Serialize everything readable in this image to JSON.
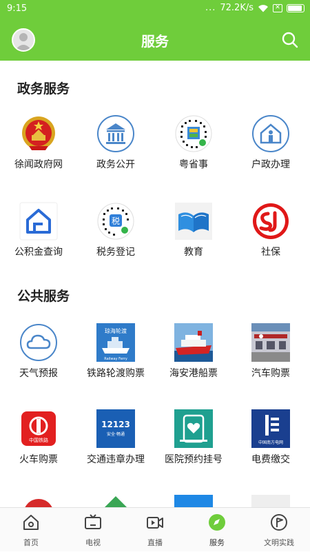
{
  "status_bar": {
    "time": "9:15",
    "dots": "...",
    "speed": "72.2K/s"
  },
  "header": {
    "title": "服务"
  },
  "sections": [
    {
      "title": "政务服务",
      "items": [
        {
          "label": "徐闻政府网",
          "icon": "national-emblem-icon"
        },
        {
          "label": "政务公开",
          "icon": "government-building-icon"
        },
        {
          "label": "粤省事",
          "icon": "mini-program-qr-icon"
        },
        {
          "label": "户政办理",
          "icon": "household-house-icon"
        },
        {
          "label": "公积金查询",
          "icon": "housing-fund-house-icon"
        },
        {
          "label": "税务登记",
          "icon": "tax-qr-icon"
        },
        {
          "label": "教育",
          "icon": "open-book-icon"
        },
        {
          "label": "社保",
          "icon": "social-security-logo-icon"
        }
      ]
    },
    {
      "title": "公共服务",
      "items": [
        {
          "label": "天气预报",
          "icon": "cloud-icon"
        },
        {
          "label": "铁路轮渡购票",
          "icon": "ferry-icon"
        },
        {
          "label": "海安港船票",
          "icon": "ship-photo-icon"
        },
        {
          "label": "汽车购票",
          "icon": "bus-station-photo-icon"
        },
        {
          "label": "火车购票",
          "icon": "china-railway-icon"
        },
        {
          "label": "交通违章办理",
          "icon": "traffic-12123-icon"
        },
        {
          "label": "医院预约挂号",
          "icon": "hospital-appointment-icon"
        },
        {
          "label": "电费缴交",
          "icon": "china-southern-grid-icon"
        }
      ]
    }
  ],
  "icon_text": {
    "ferry_top": "琼海轮渡",
    "ferry_bottom": "Railway Ferry",
    "railway": "中国铁路",
    "traffic_num": "12123",
    "traffic_sub": "安全·畅通",
    "grid": "中国南方电网"
  },
  "tabs": [
    {
      "label": "首页",
      "icon": "home-icon"
    },
    {
      "label": "电视",
      "icon": "tv-icon"
    },
    {
      "label": "直播",
      "icon": "live-video-icon"
    },
    {
      "label": "服务",
      "icon": "service-compass-icon"
    },
    {
      "label": "文明实践",
      "icon": "civilization-flag-icon"
    }
  ],
  "colors": {
    "brand": "#6fcd3b",
    "icon_blue": "#4a86c9",
    "active_tab": "#6fcd3b"
  }
}
